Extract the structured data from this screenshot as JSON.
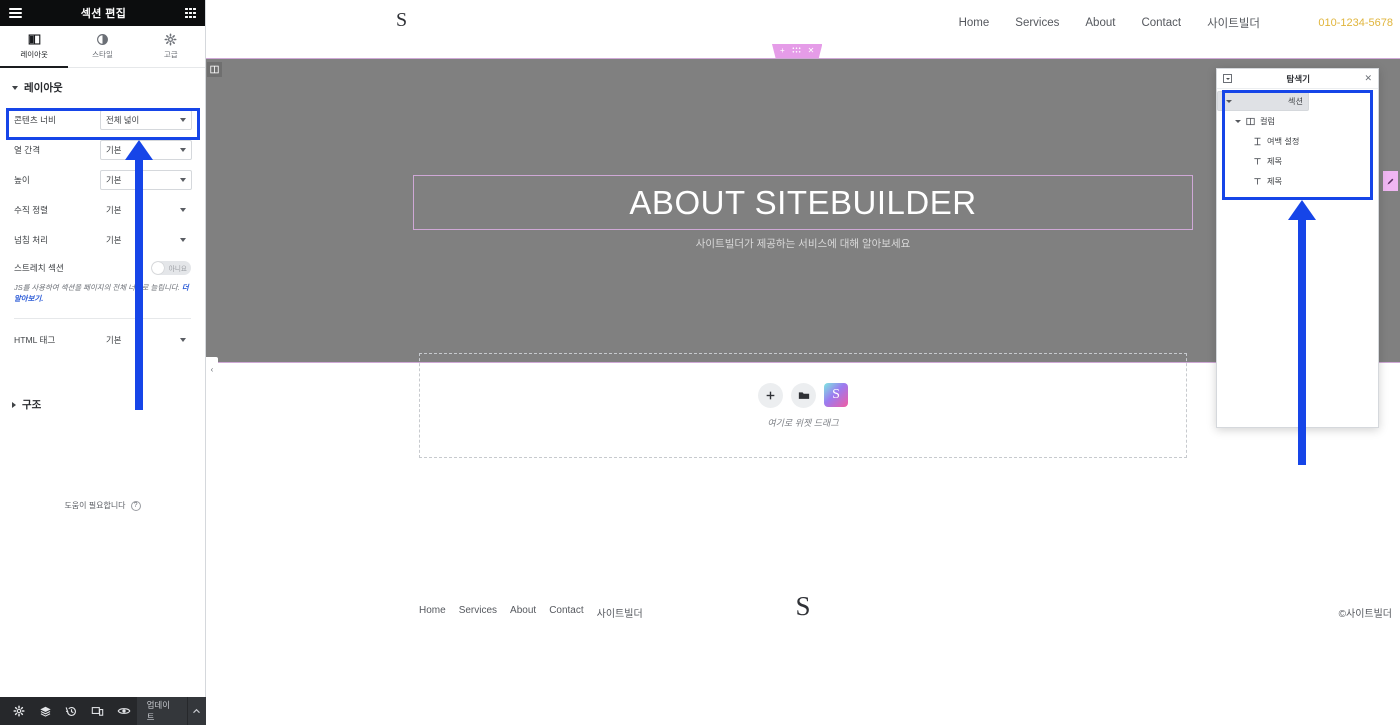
{
  "panel": {
    "topbar": {
      "title": "섹션 편집",
      "menu_icon": "hamburger-menu-icon",
      "apps_icon": "grid-apps-icon"
    },
    "tabs": [
      {
        "label": "레이아웃",
        "icon": "layout-columns-icon",
        "active": true
      },
      {
        "label": "스타일",
        "icon": "contrast-circle-icon",
        "active": false
      },
      {
        "label": "고급",
        "icon": "gear-icon",
        "active": false
      }
    ],
    "layout_section": {
      "title": "레이아웃",
      "fields": [
        {
          "label": "콘텐츠 너비",
          "value": "전체 넓이",
          "type": "select"
        },
        {
          "label": "열 간격",
          "value": "기본",
          "type": "select"
        },
        {
          "label": "높이",
          "value": "기본",
          "type": "select"
        },
        {
          "label": "수직 정렬",
          "value": "기본",
          "type": "select-borderless"
        },
        {
          "label": "넘침 처리",
          "value": "기본",
          "type": "select-borderless"
        }
      ],
      "stretch": {
        "label": "스트레치 섹션",
        "toggle_value": "아니요",
        "on": false
      },
      "note_text": "JS를 사용하여 섹션을 페이지의 전체 너비로 늘립니다. ",
      "note_link": "더 알아보기.",
      "html_tag": {
        "label": "HTML 태그",
        "value": "기본"
      }
    },
    "structure_section": {
      "title": "구조"
    },
    "help": {
      "text": "도움이 필요합니다",
      "icon": "question-mark-icon"
    },
    "bottombar": {
      "icons": [
        "gear-icon",
        "layers-icon",
        "history-icon",
        "responsive-preview-icon",
        "eye-preview-icon"
      ],
      "update_label": "업데이트",
      "caret_icon": "chevron-up-icon"
    }
  },
  "canvas": {
    "header": {
      "logo": "S",
      "nav": [
        "Home",
        "Services",
        "About",
        "Contact",
        "사이트빌더"
      ],
      "phone": "010-1234-5678"
    },
    "section_toolbar": {
      "add_icon": "+",
      "drag_icon": "drag-handle-icon",
      "close_icon": "✕"
    },
    "hero": {
      "title": "ABOUT SITEBUILDER",
      "subtitle": "사이트빌더가 제공하는 서비스에 대해 알아보세요",
      "column_badge_icon": "column-icon",
      "edit_handle_icon": "pencil-icon",
      "collapse_icon": "‹",
      "background_color": "#808080",
      "outline_color": "#cfa8d6"
    },
    "dropzone": {
      "add_icon": "+",
      "folder_icon": "folder-icon",
      "logo_icon": "sitebuilder-logo-icon",
      "logo_letter": "S",
      "text": "여기로 위젯 드래그"
    },
    "footer": {
      "nav": [
        "Home",
        "Services",
        "About",
        "Contact",
        "사이트빌더"
      ],
      "logo": "S",
      "copyright": "©사이트빌더"
    }
  },
  "navigator": {
    "title": "탐색기",
    "dock_icon": "dock-icon",
    "close_icon": "✕",
    "tree": [
      {
        "label": "섹션",
        "level": 0,
        "icon": "none",
        "expanded": true,
        "selected": true
      },
      {
        "label": "컬럼",
        "level": 1,
        "icon": "column-icon",
        "expanded": true,
        "selected": false
      },
      {
        "label": "여백 설정",
        "level": 2,
        "icon": "spacer-icon",
        "expanded": null,
        "selected": false
      },
      {
        "label": "제목",
        "level": 2,
        "icon": "heading-icon",
        "expanded": null,
        "selected": false
      },
      {
        "label": "제목",
        "level": 2,
        "icon": "heading-icon",
        "expanded": null,
        "selected": false
      }
    ]
  },
  "annotations": {
    "highlight_color": "#1645e8",
    "arrow_color": "#1645e8"
  }
}
